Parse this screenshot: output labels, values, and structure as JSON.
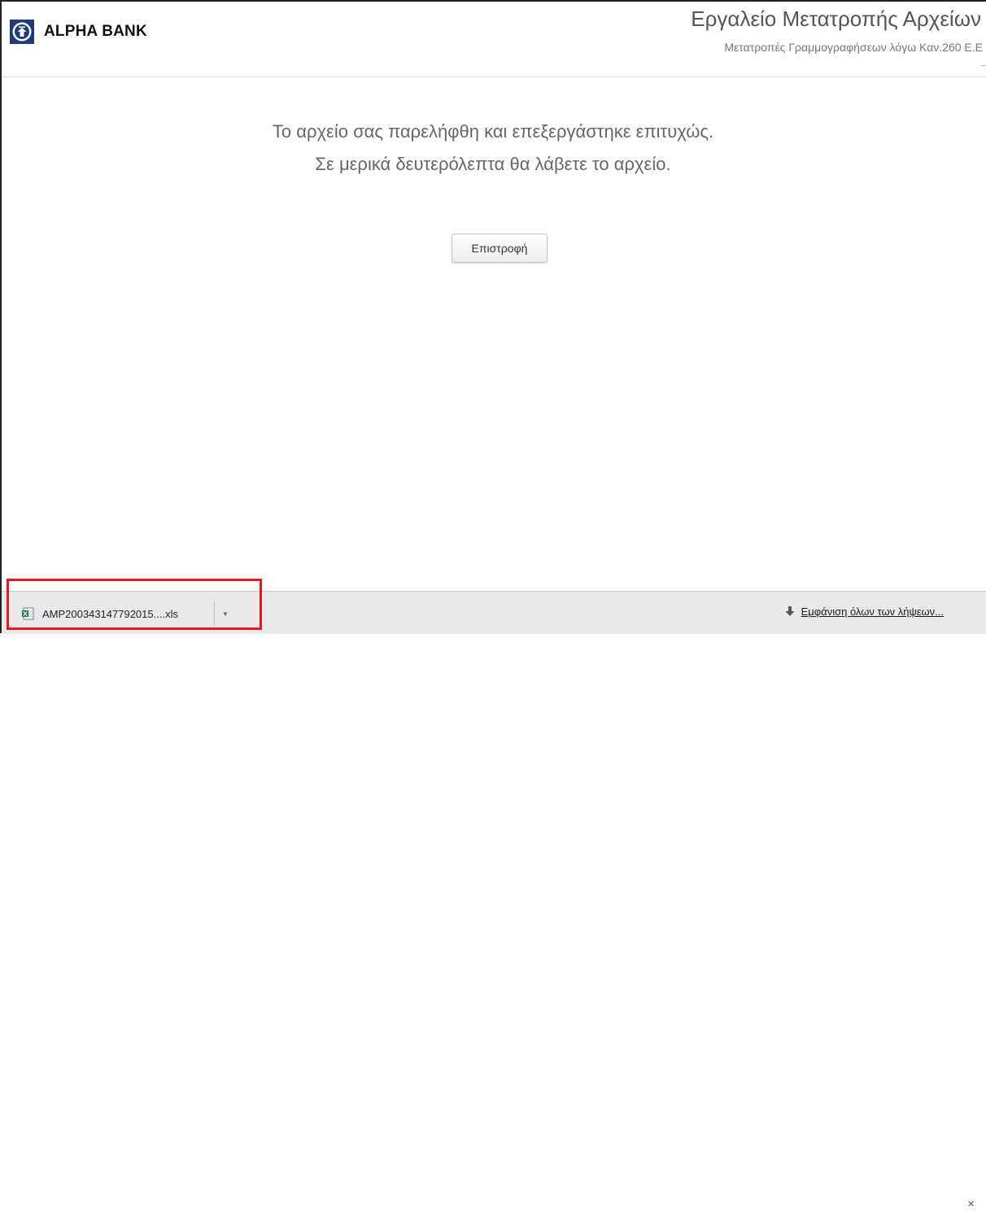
{
  "header": {
    "brand_name": "ALPHA BANK",
    "app_title": "Εργαλείο Μετατροπής Αρχείων",
    "app_subtitle": "Μετατροπές Γραμμογραφήσεων λόγω Καν.260 Ε.Ε"
  },
  "main": {
    "message_line1": "Το αρχείο σας παρελήφθη και επεξεργάστηκε επιτυχώς.",
    "message_line2": "Σε μερικά δευτερόλεπτα θα λάβετε το αρχείο.",
    "return_label": "Επιστροφή"
  },
  "download_bar": {
    "file_name": "AMP200343147792015....xls",
    "file_icon": "excel-file-icon",
    "show_all_label": "Εμφάνιση όλων των λήψεων...",
    "close_symbol": "×"
  },
  "colors": {
    "highlight_border": "#e8171f",
    "brand_blue": "#1f3c78",
    "text_gray": "#666666"
  }
}
